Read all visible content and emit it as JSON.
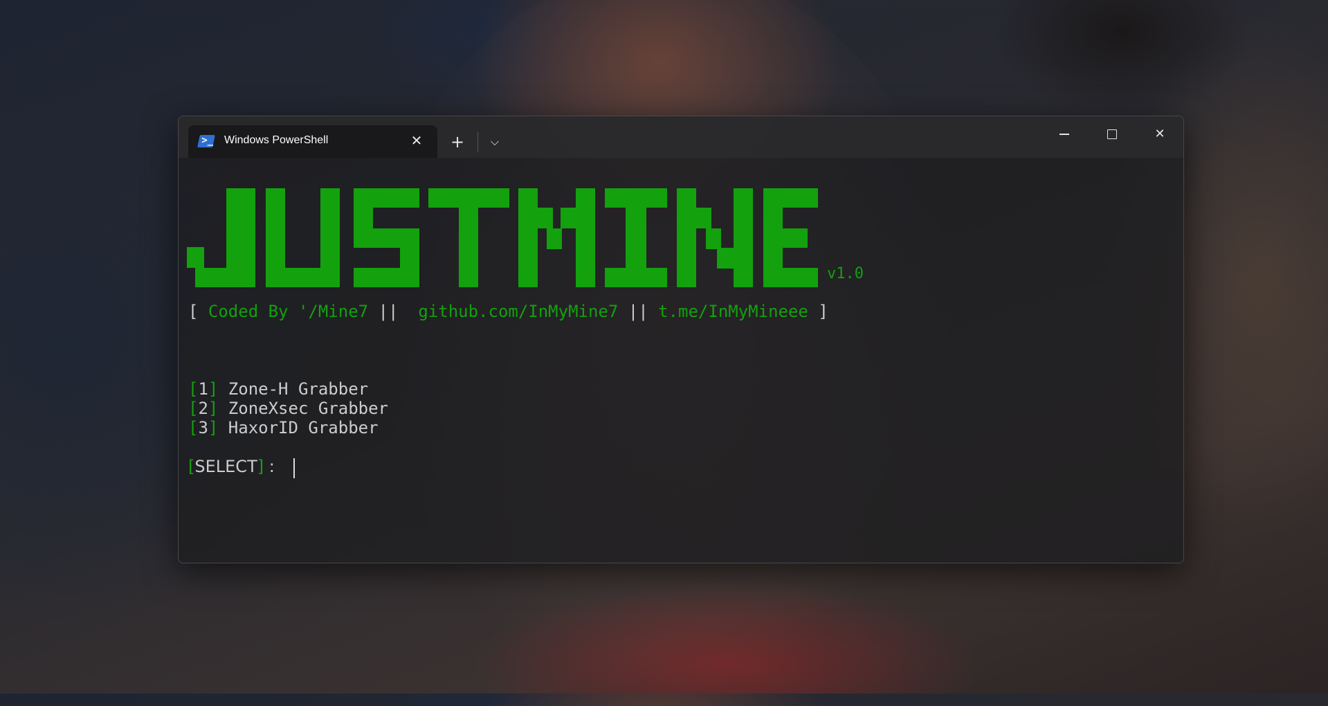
{
  "window": {
    "tab_title": "Windows PowerShell",
    "tab_icon": "powershell-icon",
    "new_tab": "+",
    "dropdown": "⌵",
    "close_tab": "✕",
    "minimize": "",
    "maximize": "",
    "close": "✕"
  },
  "terminal": {
    "banner": "JUSTMINE",
    "version": "v1.0",
    "credits": {
      "open": "[ ",
      "coded_by": "Coded By '/Mine7",
      "sep1": " ||  ",
      "github": "github.com/InMyMine7",
      "sep2": " || ",
      "telegram": "t.me/InMyMineee",
      "close": " ]"
    },
    "menu": [
      {
        "num": "1",
        "label": " Zone-H Grabber"
      },
      {
        "num": "2",
        "label": " ZoneXsec Grabber"
      },
      {
        "num": "3",
        "label": " HaxorID Grabber"
      }
    ],
    "prompt": {
      "label": "SELECT",
      "suffix": " : "
    }
  },
  "colors": {
    "accent_green": "#13a10e",
    "text": "#cccccc",
    "window_bg": "#1e1e20"
  }
}
